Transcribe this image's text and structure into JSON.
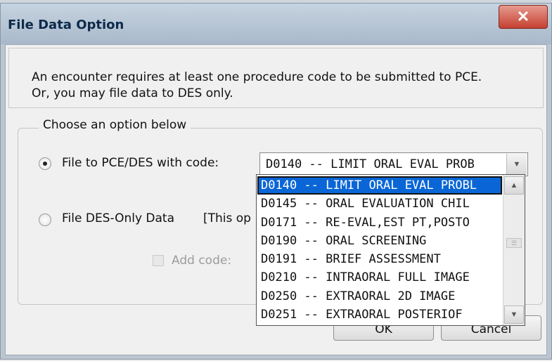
{
  "window": {
    "title": "File Data Option",
    "close_symbol": "✕"
  },
  "message": {
    "line1": "An encounter requires at least one procedure code to be submitted to PCE.",
    "line2": "Or, you may file data to DES only."
  },
  "options": {
    "group_label": "Choose an option below",
    "option1_label": "File to PCE/DES with code:",
    "option1_selected": true,
    "option2_label": "File DES-Only Data",
    "option2_note": "[This op",
    "add_code_label": "Add code:",
    "add_code_checked": false
  },
  "combo": {
    "value": "D0140 -- LIMIT ORAL EVAL PROB",
    "arrow_icon": "chevron-down-icon"
  },
  "dropdown": {
    "selected_index": 0,
    "items": [
      "D0140 -- LIMIT ORAL EVAL PROBL",
      "D0145 -- ORAL EVALUATION CHIL",
      "D0171 -- RE-EVAL,EST PT,POSTO",
      "D0190 -- ORAL SCREENING",
      "D0191 -- BRIEF ASSESSMENT",
      "D0210 -- INTRAORAL FULL IMAGE",
      "D0250 -- EXTRAORAL 2D IMAGE",
      "D0251 -- EXTRAORAL POSTERIOF"
    ]
  },
  "buttons": {
    "ok_label": "OK",
    "cancel_label": "Cancel"
  },
  "colors": {
    "selection_highlight": "#0a66d6",
    "close_button": "#c6402f"
  }
}
